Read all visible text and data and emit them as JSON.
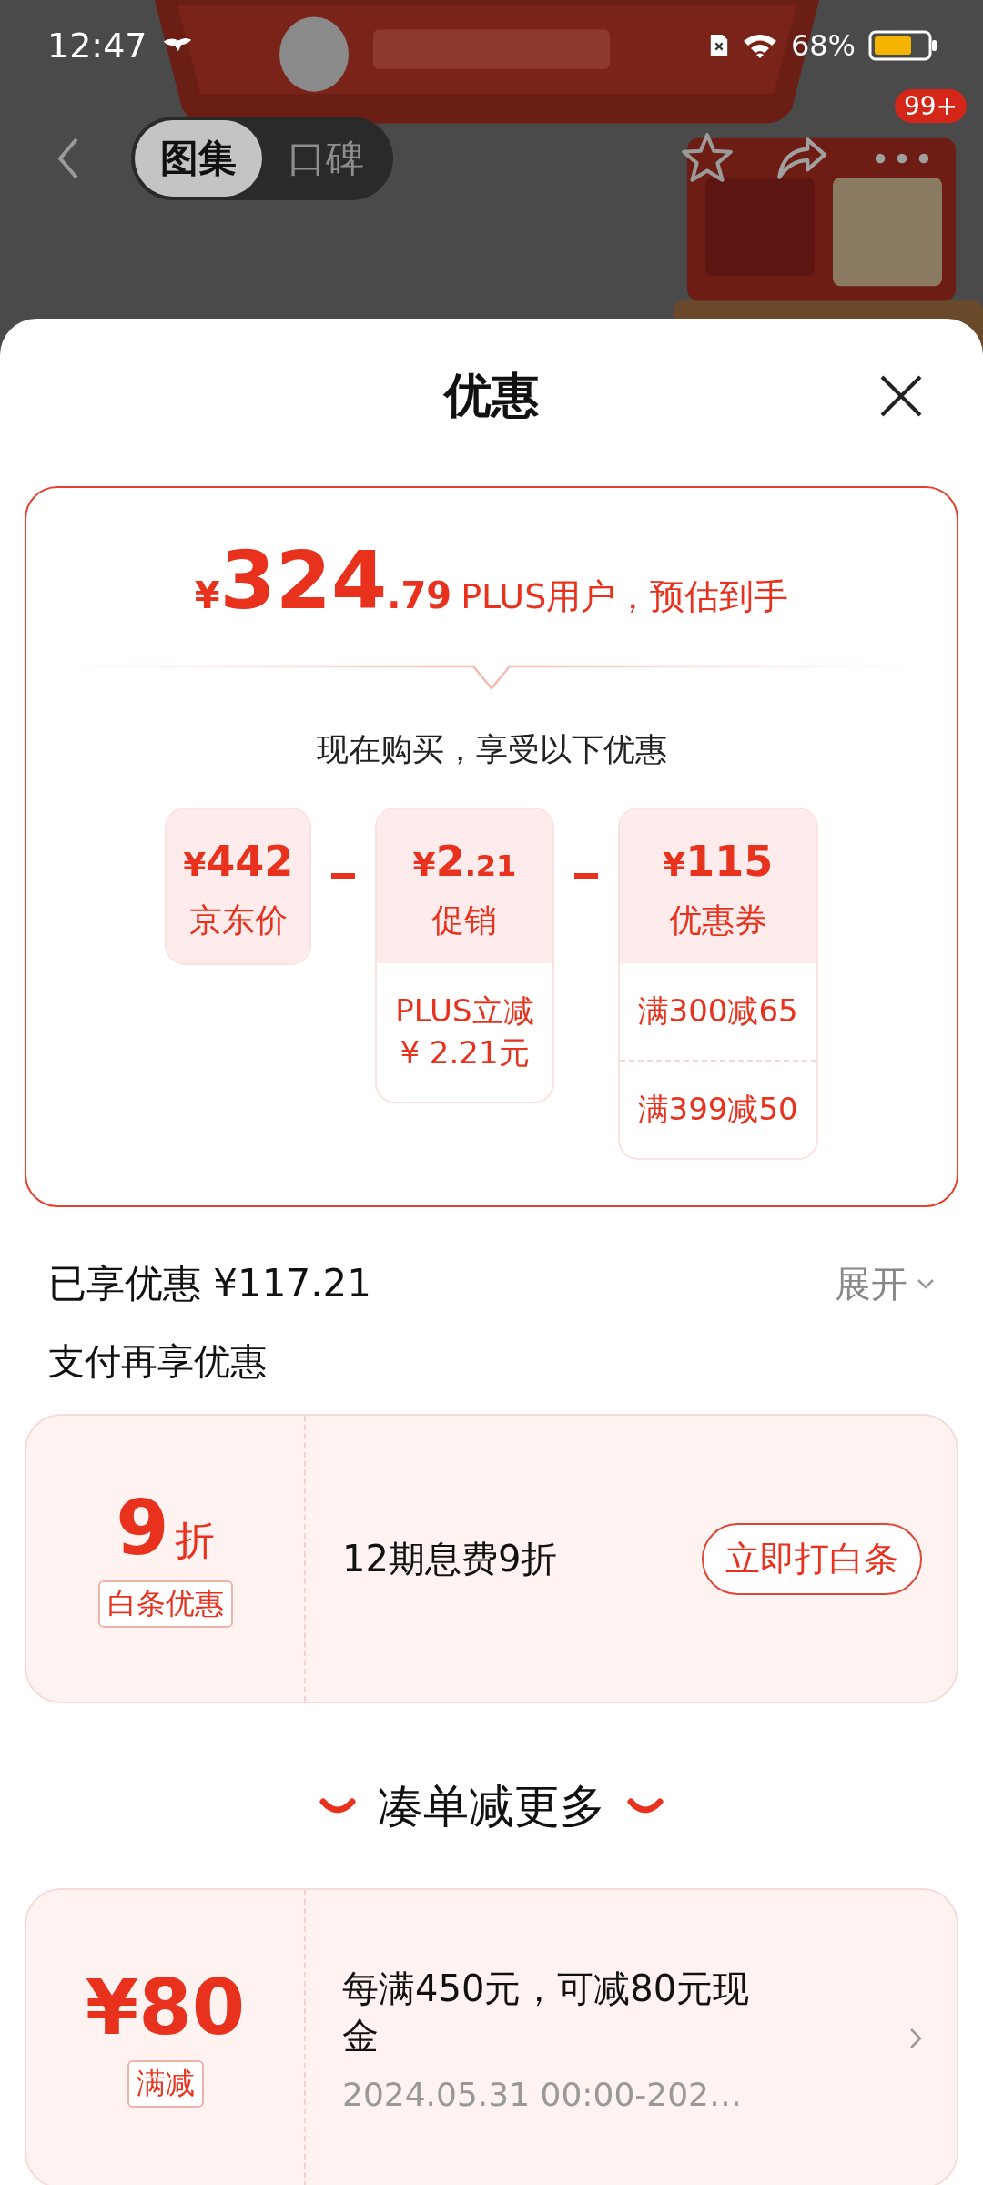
{
  "status_bar": {
    "time": "12:47",
    "battery": "68%"
  },
  "nav": {
    "tabs": [
      {
        "label": "图集",
        "selected": true
      },
      {
        "label": "口碑",
        "selected": false
      }
    ],
    "badge": "99+"
  },
  "sheet": {
    "title": "优惠",
    "summary": {
      "currency": "¥",
      "price": "324",
      "decimal": ".79",
      "note": "PLUS用户，预估到手",
      "subtitle": "现在购买，享受以下优惠",
      "breakdown": [
        {
          "currency": "¥",
          "amount": "442",
          "label": "京东价"
        },
        {
          "currency": "¥",
          "amount": "2",
          "decimal": ".21",
          "label": "促销",
          "details": [
            "PLUS立减\n¥ 2.21元"
          ]
        },
        {
          "currency": "¥",
          "amount": "115",
          "label": "优惠券",
          "details": [
            "满300减65",
            "满399减50"
          ]
        }
      ]
    },
    "applied": {
      "label": "已享优惠 ¥117.21",
      "toggle": "展开"
    },
    "pay_section": {
      "title": "支付再享优惠",
      "offer": {
        "value": "9",
        "unit": "折",
        "tag": "白条优惠",
        "description": "12期息费9折",
        "button": "立即打白条"
      }
    },
    "more_section": {
      "title": "凑单减更多",
      "offer": {
        "currency": "¥",
        "value": "80",
        "tag": "满减",
        "description": "每满450元，可减80元现金",
        "validity": "2024.05.31 00:00-202…"
      }
    }
  }
}
